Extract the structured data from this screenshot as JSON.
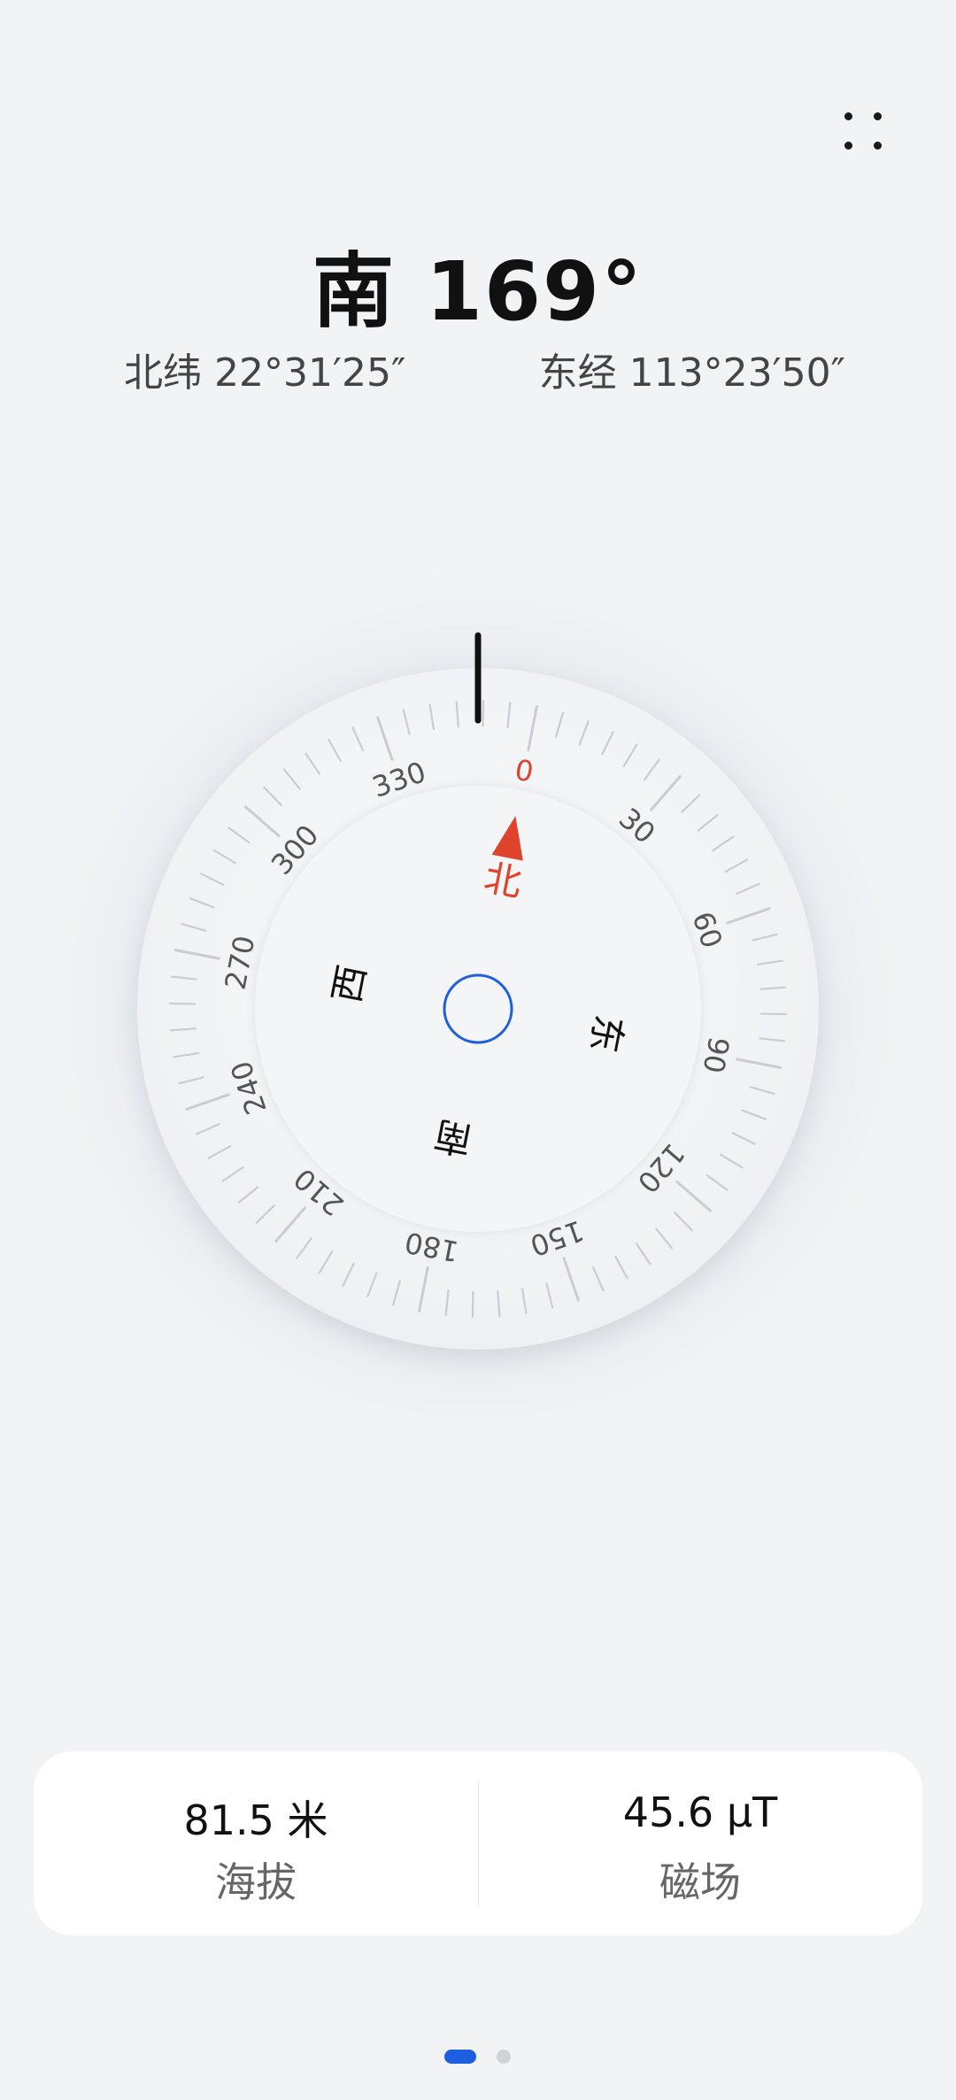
{
  "heading": {
    "direction": "南",
    "degrees": "169°"
  },
  "coordinates": {
    "latitude": "北纬 22°31′25″",
    "longitude": "东经 113°23′50″"
  },
  "compass": {
    "heading_value": 169,
    "cardinals": {
      "north": "北",
      "east": "东",
      "south": "南",
      "west": "西"
    },
    "scale_labels": [
      "0",
      "30",
      "60",
      "90",
      "120",
      "150",
      "180",
      "210",
      "240",
      "270",
      "300",
      "330"
    ],
    "colors": {
      "north_accent": "#e0432c",
      "center_ring": "#1d5fe0",
      "needle": "#111111"
    }
  },
  "info": {
    "altitude_value": "81.5 米",
    "altitude_label": "海拔",
    "magnetic_value": "45.6 µT",
    "magnetic_label": "磁场"
  },
  "pager": {
    "page_count": 2,
    "active_index": 0,
    "active_color": "#1d5fe0"
  },
  "icons": {
    "menu": "four-dots-icon"
  }
}
